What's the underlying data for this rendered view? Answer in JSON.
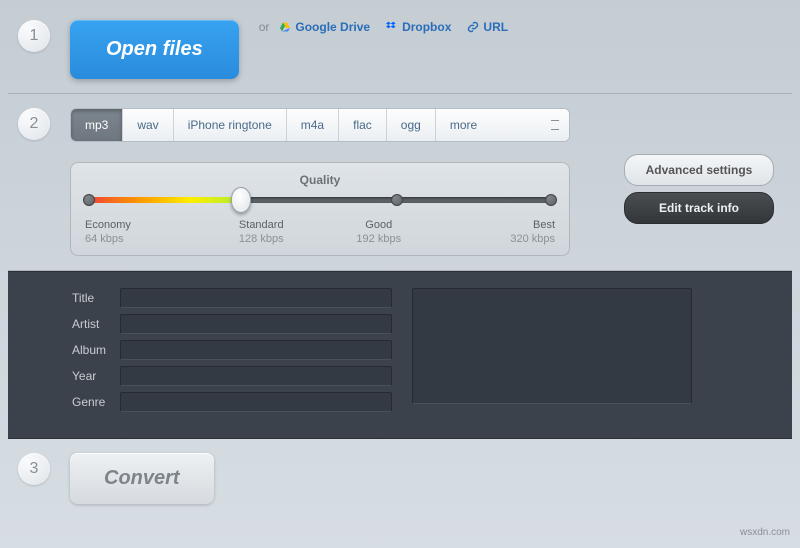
{
  "step1": {
    "number": "1",
    "open_label": "Open files",
    "or": "or",
    "google_drive": "Google Drive",
    "dropbox": "Dropbox",
    "url": "URL"
  },
  "step2": {
    "number": "2",
    "formats": [
      "mp3",
      "wav",
      "iPhone ringtone",
      "m4a",
      "flac",
      "ogg",
      "more"
    ],
    "active_format_index": 0,
    "quality_title": "Quality",
    "levels": [
      {
        "name": "Economy",
        "rate": "64 kbps"
      },
      {
        "name": "Standard",
        "rate": "128 kbps"
      },
      {
        "name": "Good",
        "rate": "192 kbps"
      },
      {
        "name": "Best",
        "rate": "320 kbps"
      }
    ],
    "slider_position_percent": 33,
    "advanced_label": "Advanced settings",
    "edit_label": "Edit track info"
  },
  "trackinfo": {
    "fields": [
      "Title",
      "Artist",
      "Album",
      "Year",
      "Genre"
    ]
  },
  "step3": {
    "number": "3",
    "convert_label": "Convert"
  },
  "watermark": "wsxdn.com"
}
